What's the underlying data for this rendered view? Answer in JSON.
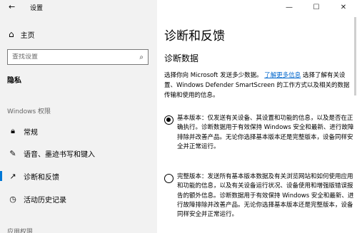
{
  "window": {
    "title": "设置",
    "minimize": "—",
    "maximize": "☐",
    "close": "✕"
  },
  "sidebar": {
    "home_label": "主页",
    "search_placeholder": "查找设置",
    "group_title": "隐私",
    "section_title": "Windows 权限",
    "items": [
      {
        "label": "常规",
        "icon": "lock-icon"
      },
      {
        "label": "语音、墨迹书写和键入",
        "icon": "ink-icon"
      },
      {
        "label": "诊断和反馈",
        "icon": "diagnostics-icon",
        "active": true
      },
      {
        "label": "活动历史记录",
        "icon": "history-icon"
      }
    ],
    "section2_title": "应用权限"
  },
  "main": {
    "title": "诊断和反馈",
    "subtitle": "诊断数据",
    "desc_before": "选择你向 Microsoft 发送多少数据。",
    "desc_link": "了解更多信息",
    "desc_after": " 选择了解有关设置、Windows Defender SmartScreen 的工作方式以及相关的数据传输和使用的信息。",
    "options": [
      {
        "checked": true,
        "text": "基本版本：仅发送有关设备、其设置和功能的信息，以及是否在正确执行。诊断数据用于有效保持 Windows 安全和最新、进行故障排除并改善产品。无论你选择基本版本还是完整版本，设备同样安全并正常运行。"
      },
      {
        "checked": false,
        "text": "完整版本：发送所有基本版本数据及有关浏览网站和如何使用应用和功能的信息，以及有关设备运行状况、设备使用和增强版错误报告的额外信息。诊断数据用于有效保持 Windows 安全和最新、进行故障排除并改善产品。无论你选择基本版本还是完整版本，设备同样安全并正常运行。"
      }
    ]
  },
  "colors": {
    "accent": "#0078d7",
    "link": "#0066cc",
    "sidebar_bg": "#f2f2f2"
  }
}
